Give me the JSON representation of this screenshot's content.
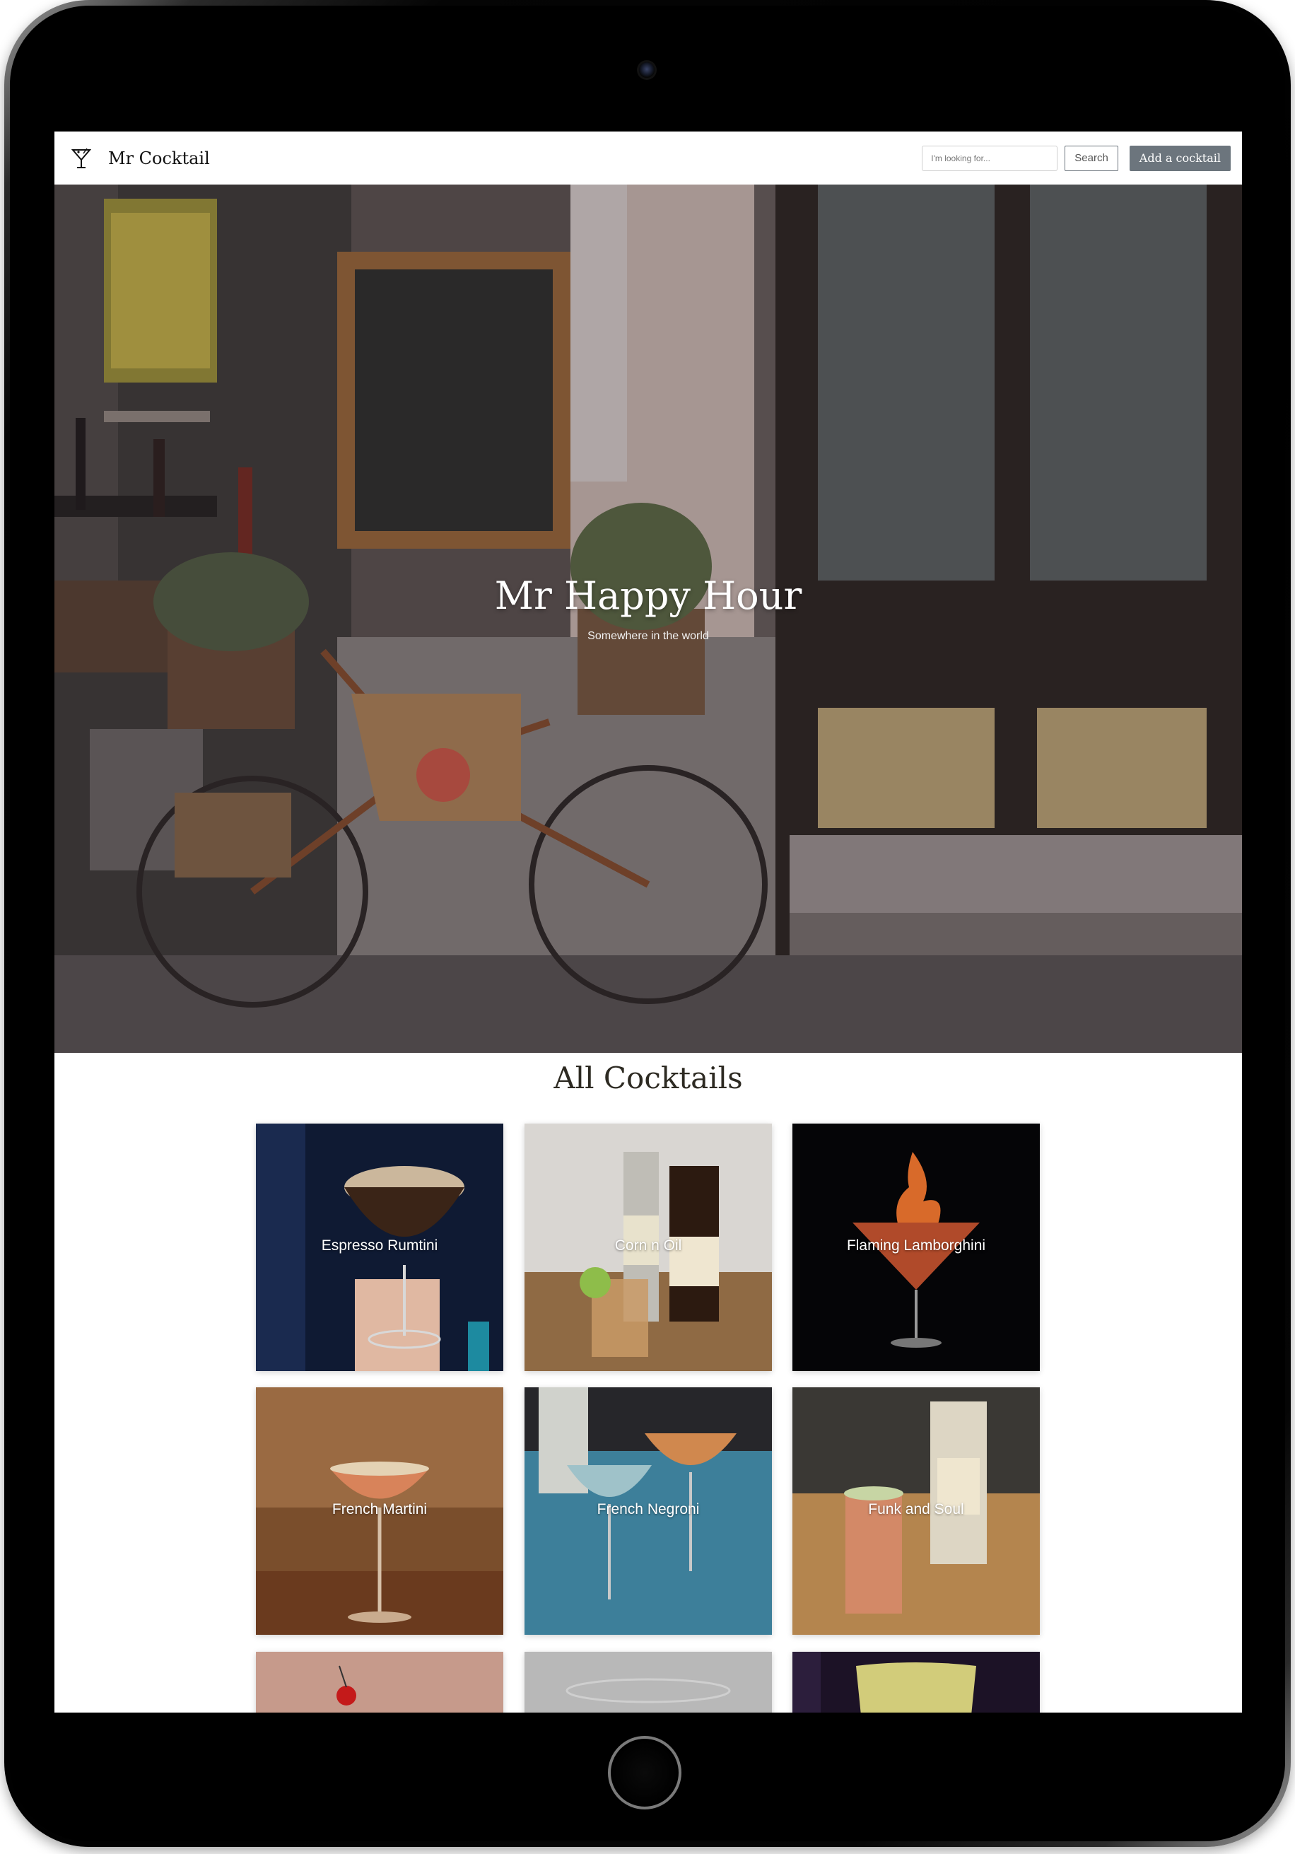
{
  "navbar": {
    "brand_name": "Mr Cocktail",
    "brand_icon": "cocktail-glass-icon",
    "search_placeholder": "I'm looking for...",
    "search_value": "",
    "search_label": "Search",
    "add_label": "Add a cocktail"
  },
  "hero": {
    "title": "Mr Happy Hour",
    "subtitle": "Somewhere in the world"
  },
  "section": {
    "title": "All Cocktails"
  },
  "cocktails": [
    {
      "name": "Espresso Rumtini"
    },
    {
      "name": "Corn n Oil"
    },
    {
      "name": "Flaming Lamborghini"
    },
    {
      "name": "French Martini"
    },
    {
      "name": "French Negroni"
    },
    {
      "name": "Funk and Soul"
    },
    {
      "name": ""
    },
    {
      "name": ""
    },
    {
      "name": ""
    }
  ],
  "colors": {
    "secondary": "#6c757d",
    "heading": "#2d2a22"
  }
}
